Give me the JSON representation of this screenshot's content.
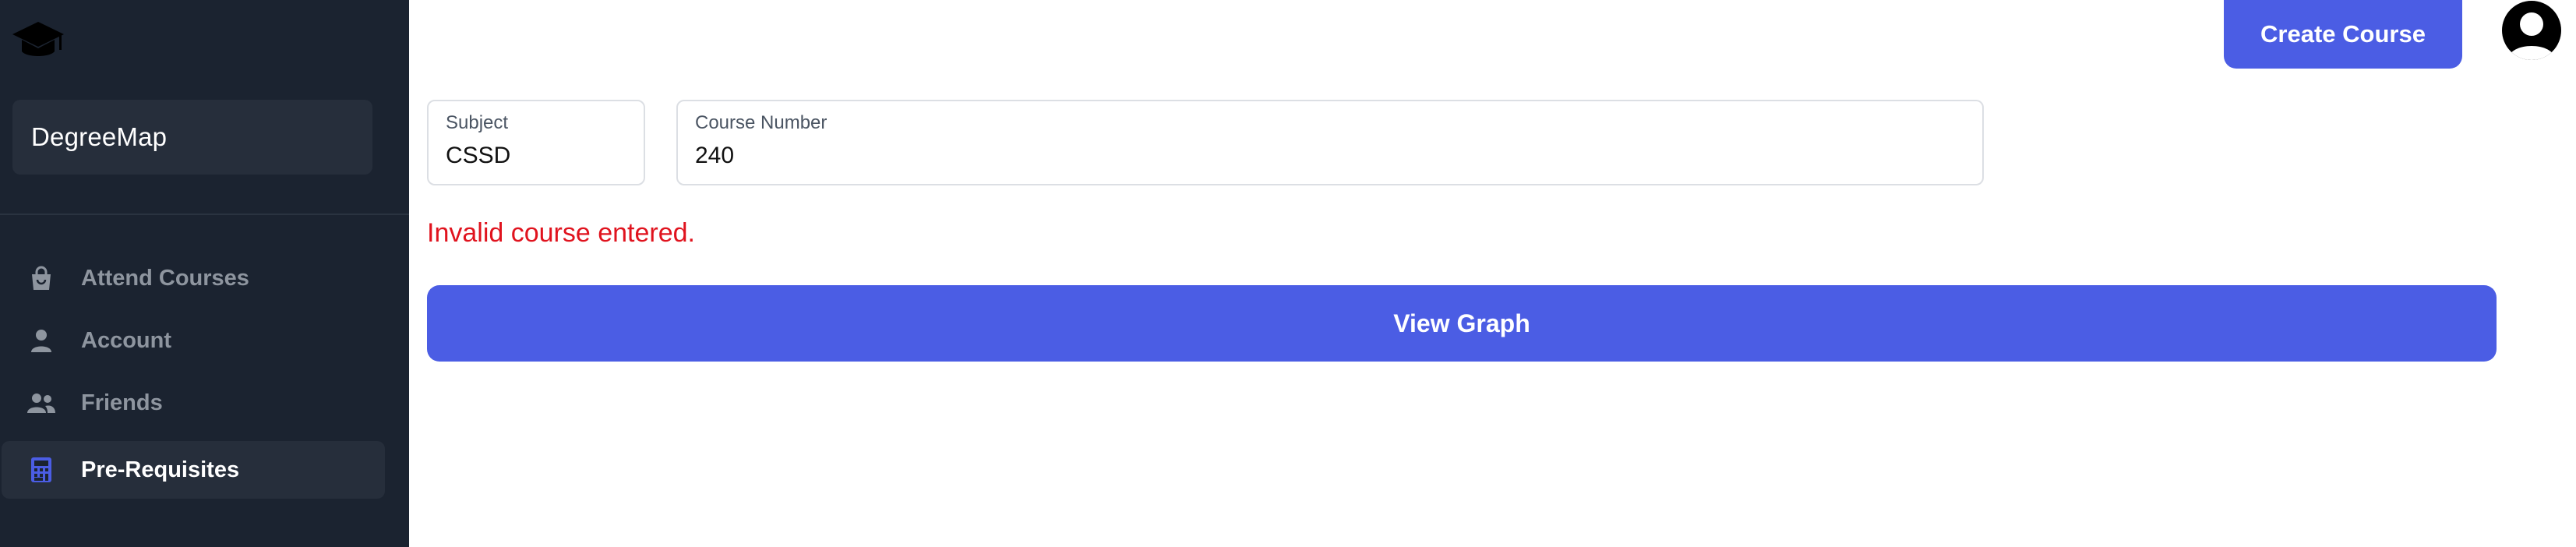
{
  "sidebar": {
    "brand": "DegreeMap",
    "logo_icon": "graduation-cap-icon",
    "items": [
      {
        "label": "Attend Courses",
        "icon": "shopping-bag-icon",
        "active": false
      },
      {
        "label": "Account",
        "icon": "user-icon",
        "active": false
      },
      {
        "label": "Friends",
        "icon": "users-icon",
        "active": false
      },
      {
        "label": "Pre-Requisites",
        "icon": "calculator-icon",
        "active": true
      }
    ]
  },
  "header": {
    "create_course_label": "Create Course",
    "avatar_icon": "user-circle-icon"
  },
  "form": {
    "subject": {
      "label": "Subject",
      "value": "CSSD"
    },
    "course_number": {
      "label": "Course Number",
      "value": "240"
    },
    "error": "Invalid course entered.",
    "submit_label": "View Graph"
  },
  "colors": {
    "sidebar_bg": "#1b2330",
    "sidebar_item_active_bg": "#262e3b",
    "accent": "#4b5de4",
    "error": "#e0131e",
    "muted_text": "#8e959f"
  }
}
